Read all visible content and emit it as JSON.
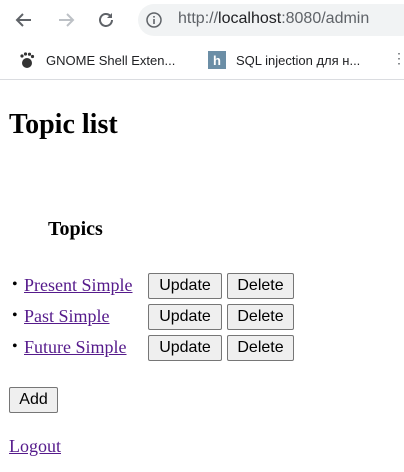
{
  "browser": {
    "url_scheme": "http://",
    "url_host": "localhost",
    "url_path": ":8080/admin",
    "bookmarks": [
      {
        "label": "GNOME Shell Exten...",
        "icon": "gnome-foot-icon"
      },
      {
        "label": "SQL injection для н...",
        "icon": "h-letter-icon"
      }
    ]
  },
  "page": {
    "title": "Topic list",
    "section_title": "Topics",
    "topics": [
      {
        "name": "Present Simple"
      },
      {
        "name": "Past Simple"
      },
      {
        "name": "Future Simple"
      }
    ],
    "update_label": "Update",
    "delete_label": "Delete",
    "add_label": "Add",
    "logout_label": "Logout"
  }
}
